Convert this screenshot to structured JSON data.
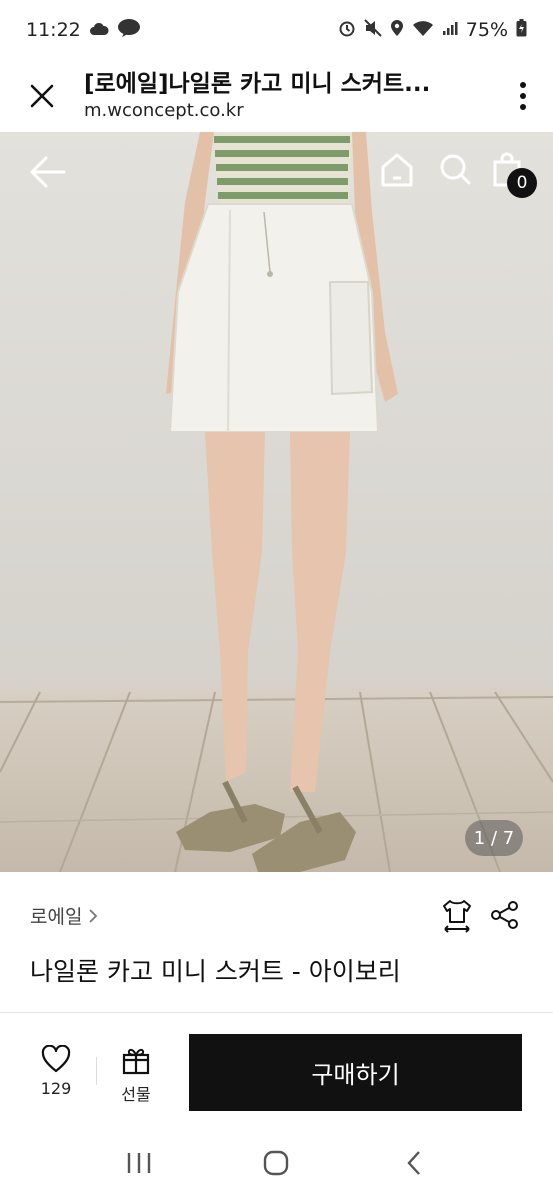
{
  "status_bar": {
    "time": "11:22",
    "talk_badge": "TALK",
    "battery": "75%"
  },
  "tab_header": {
    "title": "[로에일]나일론 카고 미니 스커트...",
    "url": "m.wconcept.co.kr",
    "close_icon": "close-icon",
    "menu_icon": "more-vertical-icon"
  },
  "photo_nav": {
    "cart_count": "0",
    "page_indicator": "1 / 7"
  },
  "product": {
    "brand": "로에일",
    "name": "나일론 카고 미니 스커트 - 아이보리"
  },
  "actions": {
    "like_count": "129",
    "gift_label": "선물",
    "buy_label": "구매하기"
  },
  "colors": {
    "buy_button": "#111111",
    "photo_wall": "#dcd9d3",
    "photo_floor": "#c9bfb2",
    "skirt": "#f2f1ec",
    "top_stripe": "#7d9c6a"
  }
}
